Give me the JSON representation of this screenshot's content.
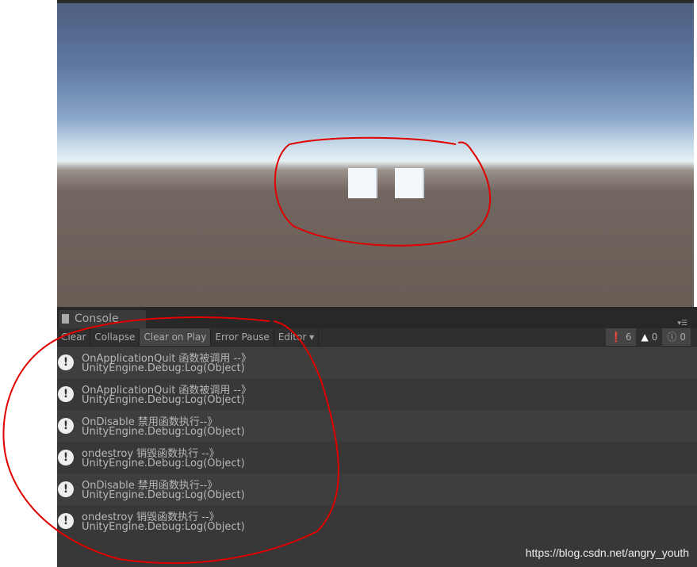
{
  "console": {
    "tab_label": "Console",
    "toolbar": {
      "clear": "Clear",
      "collapse": "Collapse",
      "clear_on_play": "Clear on Play",
      "error_pause": "Error Pause",
      "editor": "Editor ▾"
    },
    "counts": {
      "log": "6",
      "warning": "0",
      "error": "0"
    },
    "entries": [
      {
        "message": "OnApplicationQuit 函数被调用 --》",
        "stack": "UnityEngine.Debug:Log(Object)"
      },
      {
        "message": "OnApplicationQuit 函数被调用 --》",
        "stack": "UnityEngine.Debug:Log(Object)"
      },
      {
        "message": " OnDisable 禁用函数执行--》",
        "stack": "UnityEngine.Debug:Log(Object)"
      },
      {
        "message": " ondestroy 销毁函数执行 --》",
        "stack": "UnityEngine.Debug:Log(Object)"
      },
      {
        "message": " OnDisable 禁用函数执行--》",
        "stack": "UnityEngine.Debug:Log(Object)"
      },
      {
        "message": " ondestroy 销毁函数执行 --》",
        "stack": "UnityEngine.Debug:Log(Object)"
      }
    ]
  },
  "watermark": "https://blog.csdn.net/angry_youth",
  "annotation_color": "#e00000"
}
